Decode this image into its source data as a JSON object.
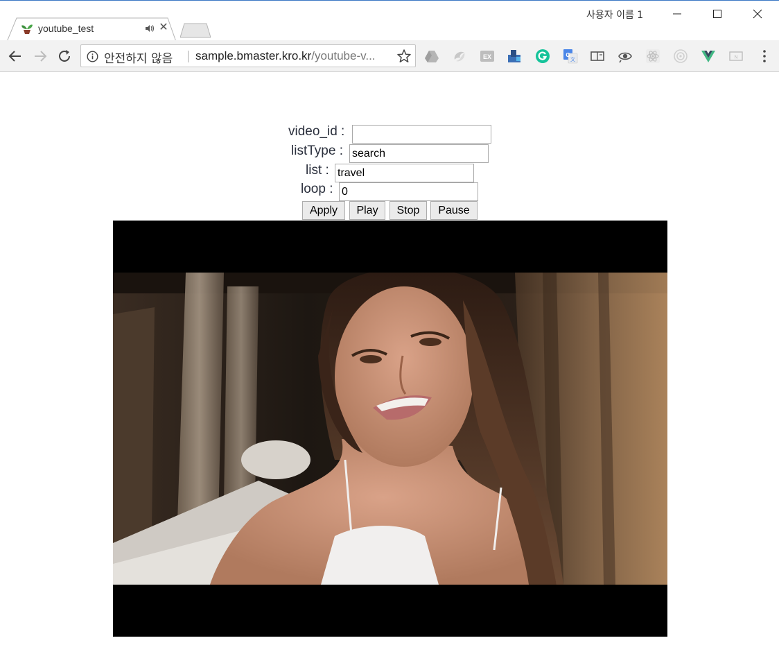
{
  "window": {
    "tab_title": "youtube_test",
    "profile_name": "사용자 이름 1",
    "icons": [
      "sprout-favicon-icon",
      "speaker-icon",
      "close-icon",
      "minimize-icon",
      "maximize-icon",
      "window-close-icon"
    ]
  },
  "toolbar": {
    "security_label": "안전하지 않음",
    "url_host": "sample.bmaster.kro.kr",
    "url_path": "/youtube-v...",
    "extensions": [
      "google-drive-icon",
      "swirl-extension-icon",
      "ex-extension-icon",
      "bookmark-extension-icon",
      "grammarly-icon",
      "google-translate-icon",
      "reader-extension-icon",
      "eye-extension-icon",
      "react-devtools-icon",
      "target-extension-icon",
      "vue-devtools-icon",
      "n-extension-icon"
    ]
  },
  "form": {
    "video_id_label": "video_id :",
    "video_id_value": "",
    "list_type_label": "listType :",
    "list_type_value": "search",
    "list_label": "list :",
    "list_value": "travel",
    "loop_label": "loop :",
    "loop_value": "0"
  },
  "buttons": {
    "apply": "Apply",
    "play": "Play",
    "stop": "Stop",
    "pause": "Pause"
  },
  "colors": {
    "accent_border": "#3b78c4",
    "grammarly": "#15c39a",
    "vue": "#41b883",
    "player_bg": "#000000"
  }
}
